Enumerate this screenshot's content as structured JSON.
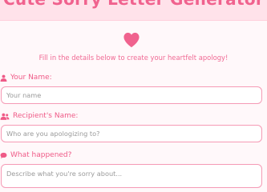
{
  "header": {
    "title": "Cute Sorry Letter Generator"
  },
  "intro": {
    "icon": "heart-icon",
    "subtitle": "Fill in the details below to create your heartfelt apology!"
  },
  "form": {
    "your_name": {
      "label": "Your Name:",
      "icon": "user-icon",
      "placeholder": "Your name"
    },
    "recipient": {
      "label": "Recipient's Name:",
      "icon": "users-icon",
      "placeholder": "Who are you apologizing to?"
    },
    "what_happened": {
      "label": "What happened?",
      "icon": "comment-icon",
      "placeholder": "Describe what you're sorry about..."
    }
  },
  "colors": {
    "accent": "#f0628e",
    "border": "#f59ab5",
    "background": "#fff8fa",
    "header_bg": "#ffe2ea"
  }
}
